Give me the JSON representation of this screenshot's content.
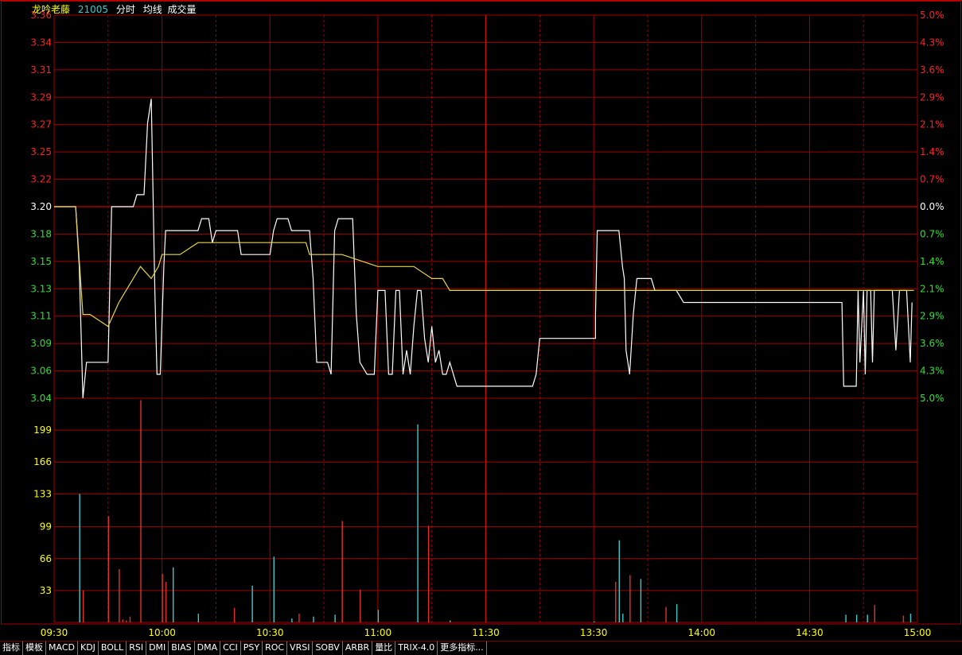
{
  "header": {
    "stock_name": "龙吟老藤",
    "stock_code": "21005",
    "menu": [
      "分时",
      "均线",
      "成交量"
    ]
  },
  "chart_data": {
    "type": "line",
    "price_axis": {
      "ticks": [
        "3.36",
        "3.34",
        "3.31",
        "3.29",
        "3.27",
        "3.25",
        "3.22",
        "3.20",
        "3.18",
        "3.15",
        "3.13",
        "3.11",
        "3.09",
        "3.06",
        "3.04"
      ],
      "ylim": [
        3.04,
        3.36
      ],
      "reference_price": 3.2
    },
    "percent_axis": {
      "ticks": [
        "5.0%",
        "4.3%",
        "3.6%",
        "2.9%",
        "2.1%",
        "1.4%",
        "0.7%",
        "0.0%",
        "0.7%",
        "1.4%",
        "2.1%",
        "2.9%",
        "3.6%",
        "4.3%",
        "5.0%"
      ]
    },
    "time_axis": {
      "ticks": [
        "09:30",
        "10:00",
        "10:30",
        "11:00",
        "11:30",
        "13:30",
        "14:00",
        "14:30",
        "15:00"
      ],
      "session_minutes": 240
    },
    "volume_axis": {
      "ticks": [
        "199",
        "166",
        "133",
        "99",
        "66",
        "33"
      ],
      "ylim": [
        0,
        232
      ]
    },
    "series": [
      {
        "kind": "price",
        "points": [
          [
            0,
            3.2
          ],
          [
            6,
            3.2
          ],
          [
            7,
            3.15
          ],
          [
            8,
            3.04
          ],
          [
            9,
            3.07
          ],
          [
            15,
            3.07
          ],
          [
            16,
            3.2
          ],
          [
            22,
            3.2
          ],
          [
            23,
            3.21
          ],
          [
            25,
            3.21
          ],
          [
            26,
            3.27
          ],
          [
            27,
            3.29
          ],
          [
            28,
            3.13
          ],
          [
            28.6,
            3.06
          ],
          [
            29.5,
            3.06
          ],
          [
            30.5,
            3.15
          ],
          [
            31,
            3.18
          ],
          [
            40,
            3.18
          ],
          [
            41,
            3.19
          ],
          [
            43,
            3.19
          ],
          [
            44,
            3.17
          ],
          [
            45,
            3.18
          ],
          [
            51,
            3.18
          ],
          [
            52,
            3.16
          ],
          [
            60,
            3.16
          ],
          [
            61,
            3.18
          ],
          [
            62,
            3.19
          ],
          [
            65,
            3.19
          ],
          [
            66,
            3.18
          ],
          [
            71,
            3.18
          ],
          [
            72,
            3.14
          ],
          [
            73,
            3.07
          ],
          [
            76,
            3.07
          ],
          [
            77,
            3.06
          ],
          [
            78,
            3.18
          ],
          [
            79,
            3.19
          ],
          [
            83,
            3.19
          ],
          [
            84,
            3.11
          ],
          [
            85,
            3.07
          ],
          [
            87,
            3.06
          ],
          [
            88,
            3.06
          ],
          [
            89,
            3.06
          ],
          [
            90,
            3.13
          ],
          [
            92,
            3.13
          ],
          [
            93,
            3.06
          ],
          [
            94,
            3.06
          ],
          [
            95,
            3.13
          ],
          [
            96,
            3.13
          ],
          [
            97,
            3.06
          ],
          [
            98,
            3.08
          ],
          [
            99,
            3.06
          ],
          [
            100,
            3.1
          ],
          [
            101,
            3.13
          ],
          [
            102,
            3.13
          ],
          [
            103,
            3.09
          ],
          [
            104,
            3.07
          ],
          [
            105,
            3.1
          ],
          [
            106,
            3.07
          ],
          [
            107,
            3.08
          ],
          [
            108,
            3.06
          ],
          [
            109,
            3.06
          ],
          [
            110,
            3.07
          ],
          [
            111,
            3.06
          ],
          [
            112,
            3.05
          ],
          [
            120,
            3.05
          ],
          [
            125,
            3.05
          ],
          [
            130,
            3.05
          ],
          [
            133,
            3.05
          ],
          [
            134,
            3.06
          ],
          [
            135,
            3.09
          ],
          [
            139,
            3.09
          ],
          [
            150,
            3.09
          ],
          [
            150.5,
            3.09
          ],
          [
            150.5,
            3.11
          ],
          [
            151,
            3.18
          ],
          [
            153,
            3.18
          ],
          [
            157,
            3.18
          ],
          [
            158,
            3.15
          ],
          [
            158.5,
            3.14
          ],
          [
            159,
            3.08
          ],
          [
            160,
            3.06
          ],
          [
            161,
            3.11
          ],
          [
            162,
            3.14
          ],
          [
            163,
            3.14
          ],
          [
            166,
            3.14
          ],
          [
            167,
            3.13
          ],
          [
            168,
            3.13
          ],
          [
            172,
            3.13
          ],
          [
            173,
            3.13
          ],
          [
            175,
            3.12
          ],
          [
            180,
            3.12
          ],
          [
            182,
            3.12
          ],
          [
            190,
            3.12
          ],
          [
            208,
            3.12
          ],
          [
            219,
            3.12
          ],
          [
            219.5,
            3.05
          ],
          [
            223,
            3.05
          ],
          [
            223.5,
            3.13
          ],
          [
            224,
            3.07
          ],
          [
            225,
            3.13
          ],
          [
            225.5,
            3.06
          ],
          [
            226,
            3.13
          ],
          [
            227,
            3.13
          ],
          [
            227.5,
            3.07
          ],
          [
            228,
            3.13
          ],
          [
            233,
            3.13
          ],
          [
            234,
            3.08
          ],
          [
            235,
            3.13
          ],
          [
            237,
            3.13
          ],
          [
            238,
            3.07
          ],
          [
            238.5,
            3.12
          ]
        ]
      },
      {
        "kind": "average",
        "points": [
          [
            0,
            3.2
          ],
          [
            6,
            3.2
          ],
          [
            8,
            3.11
          ],
          [
            10,
            3.11
          ],
          [
            15,
            3.1
          ],
          [
            18,
            3.12
          ],
          [
            20,
            3.13
          ],
          [
            22,
            3.14
          ],
          [
            24,
            3.15
          ],
          [
            27,
            3.14
          ],
          [
            29,
            3.15
          ],
          [
            30,
            3.16
          ],
          [
            35,
            3.16
          ],
          [
            40,
            3.17
          ],
          [
            45,
            3.17
          ],
          [
            50,
            3.17
          ],
          [
            60,
            3.17
          ],
          [
            70,
            3.17
          ],
          [
            71,
            3.16
          ],
          [
            73,
            3.16
          ],
          [
            80,
            3.16
          ],
          [
            90,
            3.15
          ],
          [
            95,
            3.15
          ],
          [
            100,
            3.15
          ],
          [
            105,
            3.14
          ],
          [
            108,
            3.14
          ],
          [
            110,
            3.13
          ],
          [
            111,
            3.13
          ],
          [
            120,
            3.13
          ],
          [
            150,
            3.13
          ],
          [
            165,
            3.13
          ],
          [
            170,
            3.13
          ],
          [
            175,
            3.13
          ],
          [
            180,
            3.13
          ],
          [
            200,
            3.13
          ],
          [
            215,
            3.13
          ],
          [
            220,
            3.13
          ],
          [
            230,
            3.13
          ],
          [
            238,
            3.13
          ],
          [
            239,
            3.13
          ]
        ]
      }
    ],
    "volume": [
      [
        7,
        133,
        "up"
      ],
      [
        8,
        33,
        "down"
      ],
      [
        15,
        110,
        "down"
      ],
      [
        18,
        55,
        "down"
      ],
      [
        19,
        3,
        "down"
      ],
      [
        20,
        2,
        "down"
      ],
      [
        21,
        6,
        "down"
      ],
      [
        24,
        230,
        "down"
      ],
      [
        30,
        50,
        "down"
      ],
      [
        31,
        42,
        "down"
      ],
      [
        33,
        57,
        "up"
      ],
      [
        40,
        9,
        "up"
      ],
      [
        50,
        15,
        "down"
      ],
      [
        55,
        38,
        "up"
      ],
      [
        61,
        68,
        "up"
      ],
      [
        66,
        4,
        "up"
      ],
      [
        68,
        9,
        "down"
      ],
      [
        72,
        6,
        "up"
      ],
      [
        78,
        8,
        "up"
      ],
      [
        80,
        105,
        "down"
      ],
      [
        85,
        34,
        "down"
      ],
      [
        90,
        13,
        "up"
      ],
      [
        101,
        205,
        "up"
      ],
      [
        104,
        100,
        "down"
      ],
      [
        110,
        2,
        "up"
      ],
      [
        150,
        1,
        "up"
      ],
      [
        156,
        42,
        "down"
      ],
      [
        157,
        85,
        "up"
      ],
      [
        158,
        9,
        "up"
      ],
      [
        160,
        49,
        "down"
      ],
      [
        163,
        45,
        "up"
      ],
      [
        170,
        16,
        "down"
      ],
      [
        173,
        19,
        "up"
      ],
      [
        220,
        8,
        "up"
      ],
      [
        223,
        8,
        "up"
      ],
      [
        226,
        8,
        "up"
      ],
      [
        228,
        18,
        "down"
      ],
      [
        236,
        7,
        "down"
      ],
      [
        238,
        9,
        "up"
      ]
    ],
    "colors": {
      "grid": "#a00000",
      "price_line": "#ffffff",
      "average_line": "#e8d44a",
      "volume_up": "#40c8c8",
      "volume_down": "#e03030",
      "axis_up": "#ff2020",
      "axis_flat": "#ffffff",
      "axis_down": "#30e030",
      "volume_axis_label": "#ffff00",
      "time_label": "#ffff00"
    }
  },
  "tabs": [
    "指标",
    "模板",
    "MACD",
    "KDJ",
    "BOLL",
    "RSI",
    "DMI",
    "BIAS",
    "DMA",
    "CCI",
    "PSY",
    "ROC",
    "VRSI",
    "SOBV",
    "ARBR",
    "量比",
    "TRIX-4.0",
    "更多指标..."
  ]
}
